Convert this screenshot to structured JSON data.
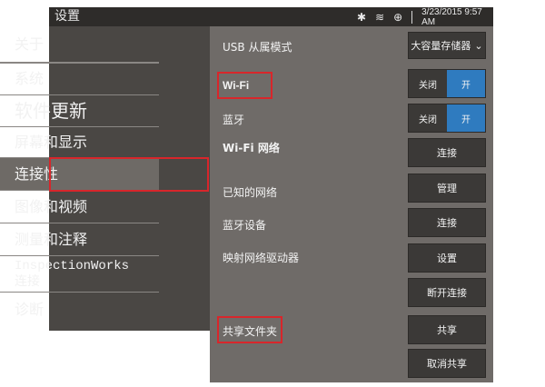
{
  "status_bar": {
    "title": "设置",
    "bluetooth_icon": "✱",
    "wifi_icon": "≋",
    "usb_icon": "⊕",
    "datetime": "3/23/2015  9:57 AM"
  },
  "sidebar": {
    "items": [
      {
        "label": "关于"
      },
      {
        "label": "系统"
      },
      {
        "label": "软件更新"
      },
      {
        "label": "屏幕和显示"
      },
      {
        "label": "连接性"
      },
      {
        "label": "图像和视频"
      },
      {
        "label": "测量和注释"
      },
      {
        "label": "InspectionWorks\n连接"
      },
      {
        "label": "诊断"
      }
    ],
    "active_index": 4
  },
  "settings": {
    "usb_mode": {
      "label": "USB 从属模式",
      "value": "大容量存储器"
    },
    "wifi": {
      "label": "Wi-Fi",
      "off": "关闭",
      "on": "开"
    },
    "bluetooth": {
      "label": "蓝牙",
      "off": "关闭",
      "on": "开"
    },
    "wifi_network": {
      "label": "Wi-Fi 网络",
      "button": "连接"
    },
    "known_networks": {
      "label": "已知的网络",
      "button": "管理"
    },
    "bluetooth_devices": {
      "label": "蓝牙设备",
      "button": "连接"
    },
    "map_network_drive": {
      "label": "映射网络驱动器",
      "button": "设置",
      "button2": "断开连接"
    },
    "shared_folder": {
      "label": "共享文件夹",
      "button": "共享",
      "button2": "取消共享"
    }
  },
  "colors": {
    "highlight": "#d8262b",
    "toggle_on": "#2f7bbf"
  }
}
